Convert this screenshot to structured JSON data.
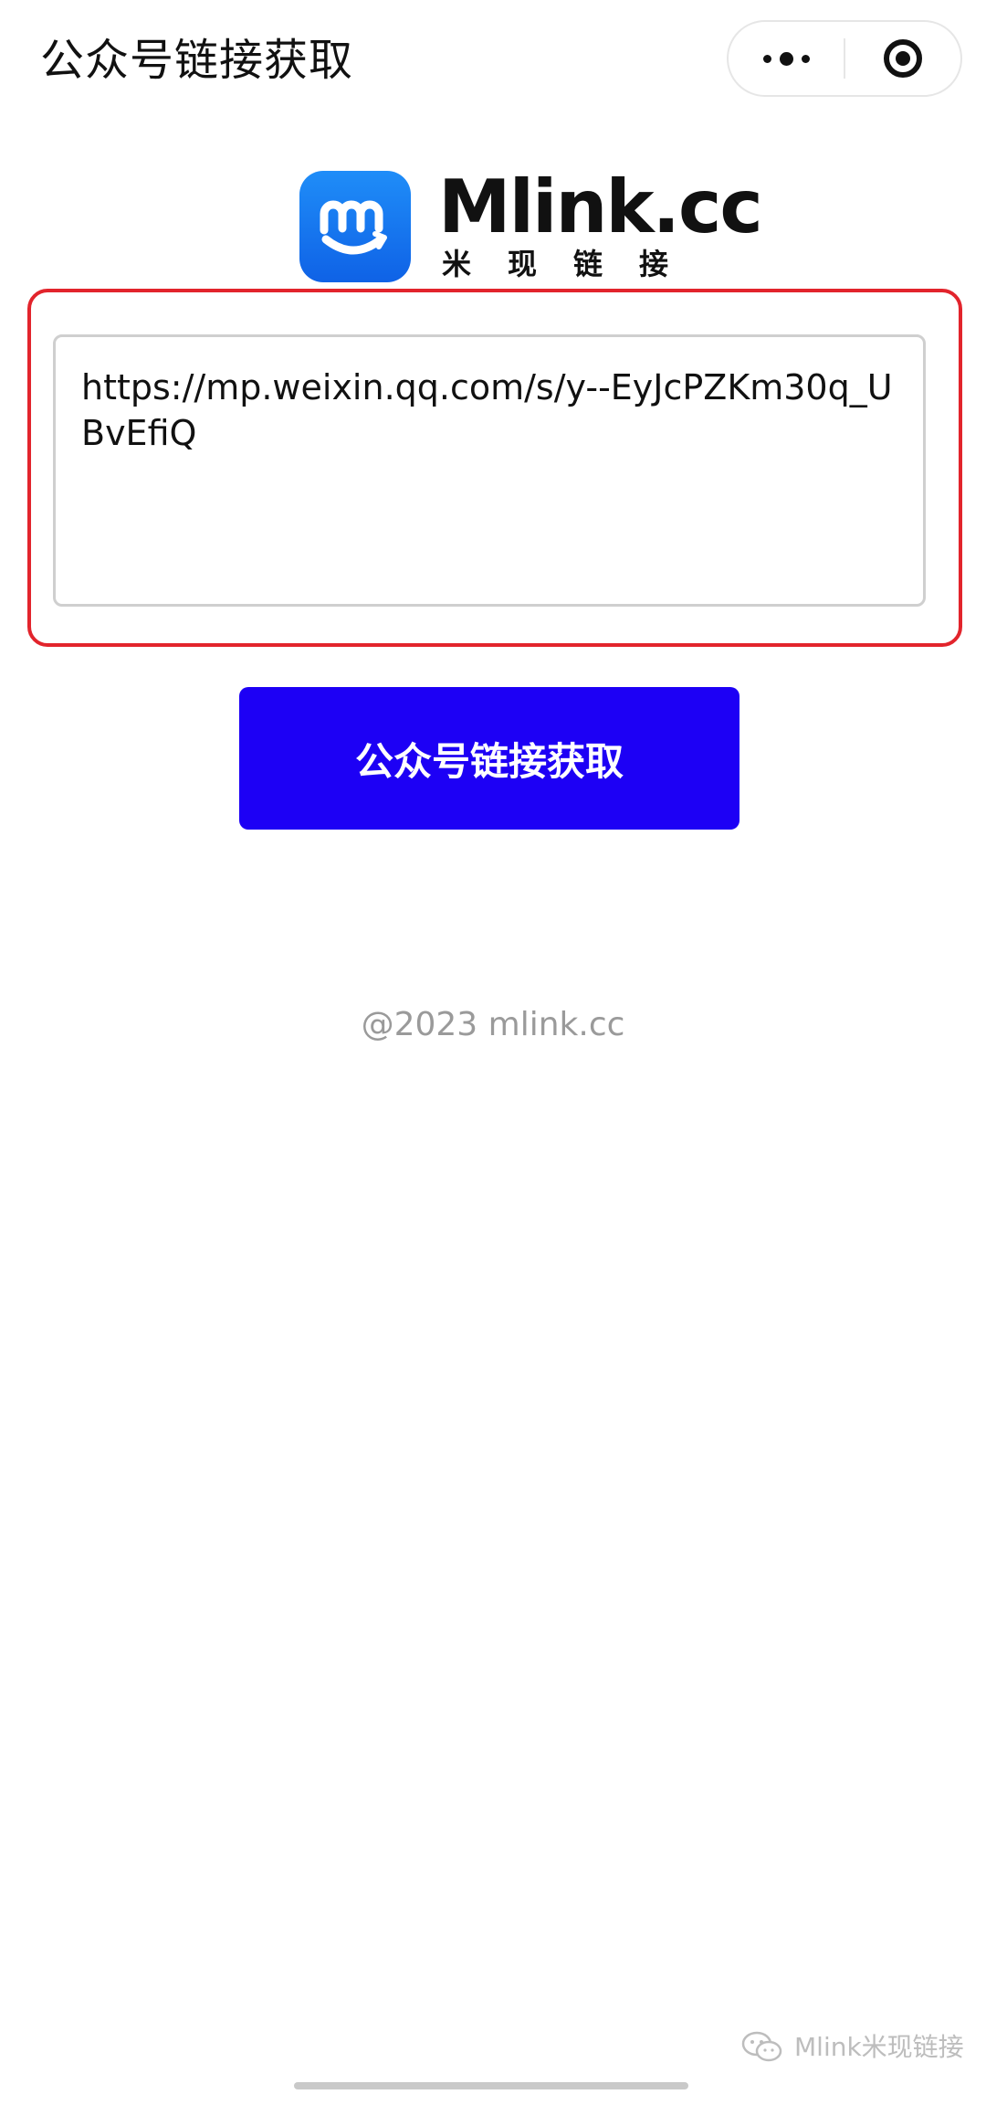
{
  "topbar": {
    "title": "公众号链接获取",
    "more_icon": "more-dots-icon",
    "close_icon": "target-close-icon"
  },
  "logo": {
    "name": "Mlink.cc",
    "subtitle": "米现链接",
    "icon": "mlink-logo-icon"
  },
  "form": {
    "url_value": "https://mp.weixin.qq.com/s/y--EyJcPZKm30q_UBvEfiQ",
    "submit_label": "公众号链接获取"
  },
  "footer": {
    "copyright": "@2023 mlink.cc",
    "watermark": "Mlink米现链接",
    "watermark_icon": "wechat-icon"
  },
  "colors": {
    "button_blue": "#1d00f5",
    "highlight_red": "#e2242c",
    "logo_blue": "#1677f0"
  }
}
